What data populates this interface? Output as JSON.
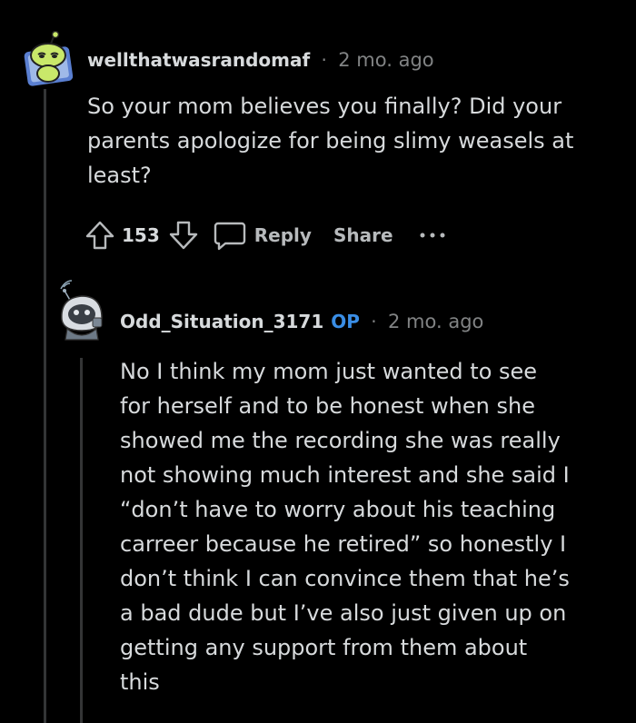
{
  "comments": [
    {
      "username": "wellthatwasrandomaf",
      "separator": "·",
      "timestamp": "2 mo. ago",
      "body_lines": [
        "So your mom believes you finally? Did your",
        "parents apologize for being slimy weasels at",
        "least?"
      ],
      "actions": {
        "vote_count": "153",
        "reply_label": "Reply",
        "share_label": "Share",
        "upvote_icon": "arrow-up-icon",
        "downvote_icon": "arrow-down-icon",
        "reply_icon": "speech-bubble-icon",
        "more_icon": "more-dots-icon"
      }
    },
    {
      "username": "Odd_Situation_3171",
      "op_badge": "OP",
      "separator": "·",
      "timestamp": "2 mo. ago",
      "body_lines": [
        "No I think my mom just wanted to see",
        "for herself and to be honest when she",
        "showed me the recording she was really",
        "not showing much interest and she said I",
        "“don’t have to worry about his teaching",
        "carreer because he retired” so honestly I",
        "don’t think I can convince them that he’s",
        "a bad dude but I’ve also just given up on",
        "getting any support from them about",
        "this"
      ]
    }
  ],
  "colors": {
    "background": "#000000",
    "text": "#d7dadc",
    "meta": "#818384",
    "op_badge": "#3a8ee6",
    "thread_line": "#343536"
  }
}
